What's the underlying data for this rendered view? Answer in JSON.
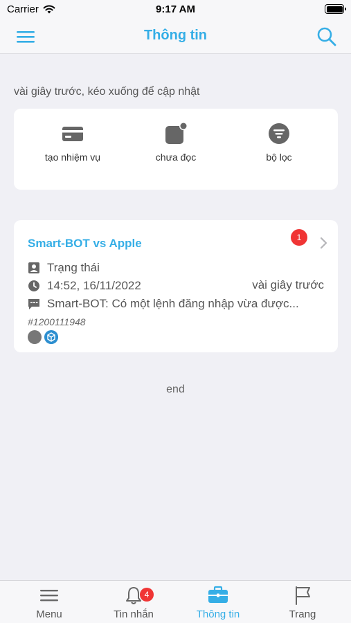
{
  "status_bar": {
    "carrier": "Carrier",
    "time": "9:17 AM"
  },
  "header": {
    "title": "Thông tin",
    "menu_icon": "hamburger-menu-icon",
    "search_icon": "search-icon"
  },
  "refresh_hint": "vài giây trước, kéo xuống để cập nhật",
  "actions": [
    {
      "label": "tạo nhiệm vụ",
      "icon": "card-icon"
    },
    {
      "label": "chưa đọc",
      "icon": "unread-icon"
    },
    {
      "label": "bộ lọc",
      "icon": "filter-icon"
    }
  ],
  "task": {
    "title": "Smart-BOT vs Apple",
    "unread_count": "1",
    "status": "Trạng thái",
    "datetime": "14:52, 16/11/2022",
    "relative_time": "vài giây trước",
    "message": "Smart-BOT: Có một lệnh đăng nhập vừa được...",
    "id": "#1200111948"
  },
  "end_label": "end",
  "tabs": [
    {
      "label": "Menu",
      "icon": "menu-icon",
      "active": false
    },
    {
      "label": "Tin nhắn",
      "icon": "bell-icon",
      "badge": "4",
      "active": false
    },
    {
      "label": "Thông tin",
      "icon": "briefcase-icon",
      "active": true
    },
    {
      "label": "Trang",
      "icon": "flag-icon",
      "active": false
    }
  ],
  "colors": {
    "accent": "#35aee6",
    "badge": "#f03535",
    "background": "#f0f0f5"
  }
}
